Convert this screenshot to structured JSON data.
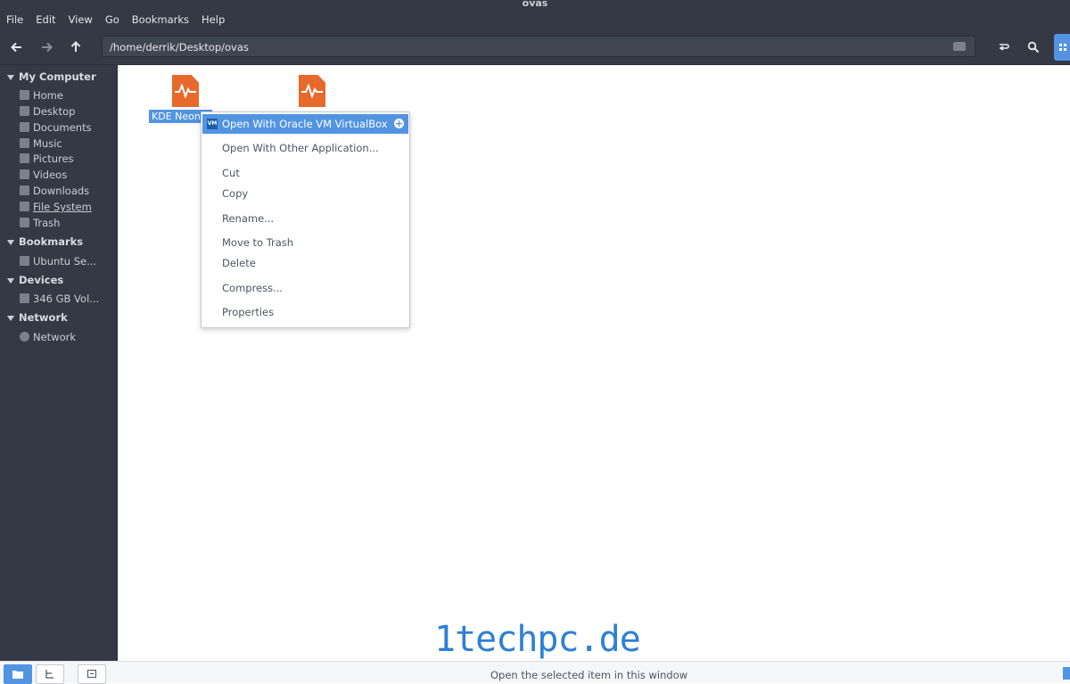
{
  "window": {
    "title": "ovas"
  },
  "menubar": [
    "File",
    "Edit",
    "View",
    "Go",
    "Bookmarks",
    "Help"
  ],
  "toolbar": {
    "path": "/home/derrik/Desktop/ovas"
  },
  "sidebar": {
    "sections": [
      {
        "title": "My Computer",
        "items": [
          "Home",
          "Desktop",
          "Documents",
          "Music",
          "Pictures",
          "Videos",
          "Downloads",
          "File System",
          "Trash"
        ]
      },
      {
        "title": "Bookmarks",
        "items": [
          "Ubuntu Se..."
        ]
      },
      {
        "title": "Devices",
        "items": [
          "346 GB Vol..."
        ]
      },
      {
        "title": "Network",
        "items": [
          "Network"
        ]
      }
    ]
  },
  "files": [
    {
      "label": "KDE Neon..."
    }
  ],
  "context_menu": {
    "items": [
      "Open With Oracle VM VirtualBox",
      "Open With Other Application...",
      "Cut",
      "Copy",
      "Rename...",
      "Move to Trash",
      "Delete",
      "Compress...",
      "Properties"
    ],
    "vbox_badge": "VM"
  },
  "statusbar": {
    "text": "Open the selected item in this window"
  },
  "watermark": "1techpc.de",
  "colors": {
    "accent": "#5294e2",
    "chrome": "#353945",
    "file_icon": "#e8692c"
  }
}
